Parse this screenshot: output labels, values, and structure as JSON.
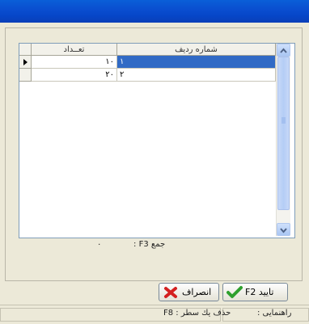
{
  "grid": {
    "columns": [
      "شماره ردیف",
      "تعــداد"
    ],
    "rows": [
      {
        "row_number": "١",
        "quantity": "١٠"
      },
      {
        "row_number": "٢",
        "quantity": "٢٠"
      }
    ]
  },
  "sum": {
    "label": "جمع F3 :",
    "value": "٠"
  },
  "buttons": {
    "confirm_label": "تایید F2",
    "cancel_label": "انصراف"
  },
  "status": {
    "help_label": "راهنمایی :",
    "help_text": "حذف یك سطر : F8"
  },
  "colors": {
    "title_blue": "#0a4fd0",
    "selection": "#316ac5",
    "confirm_green": "#2ea02e",
    "cancel_red": "#d42020"
  }
}
